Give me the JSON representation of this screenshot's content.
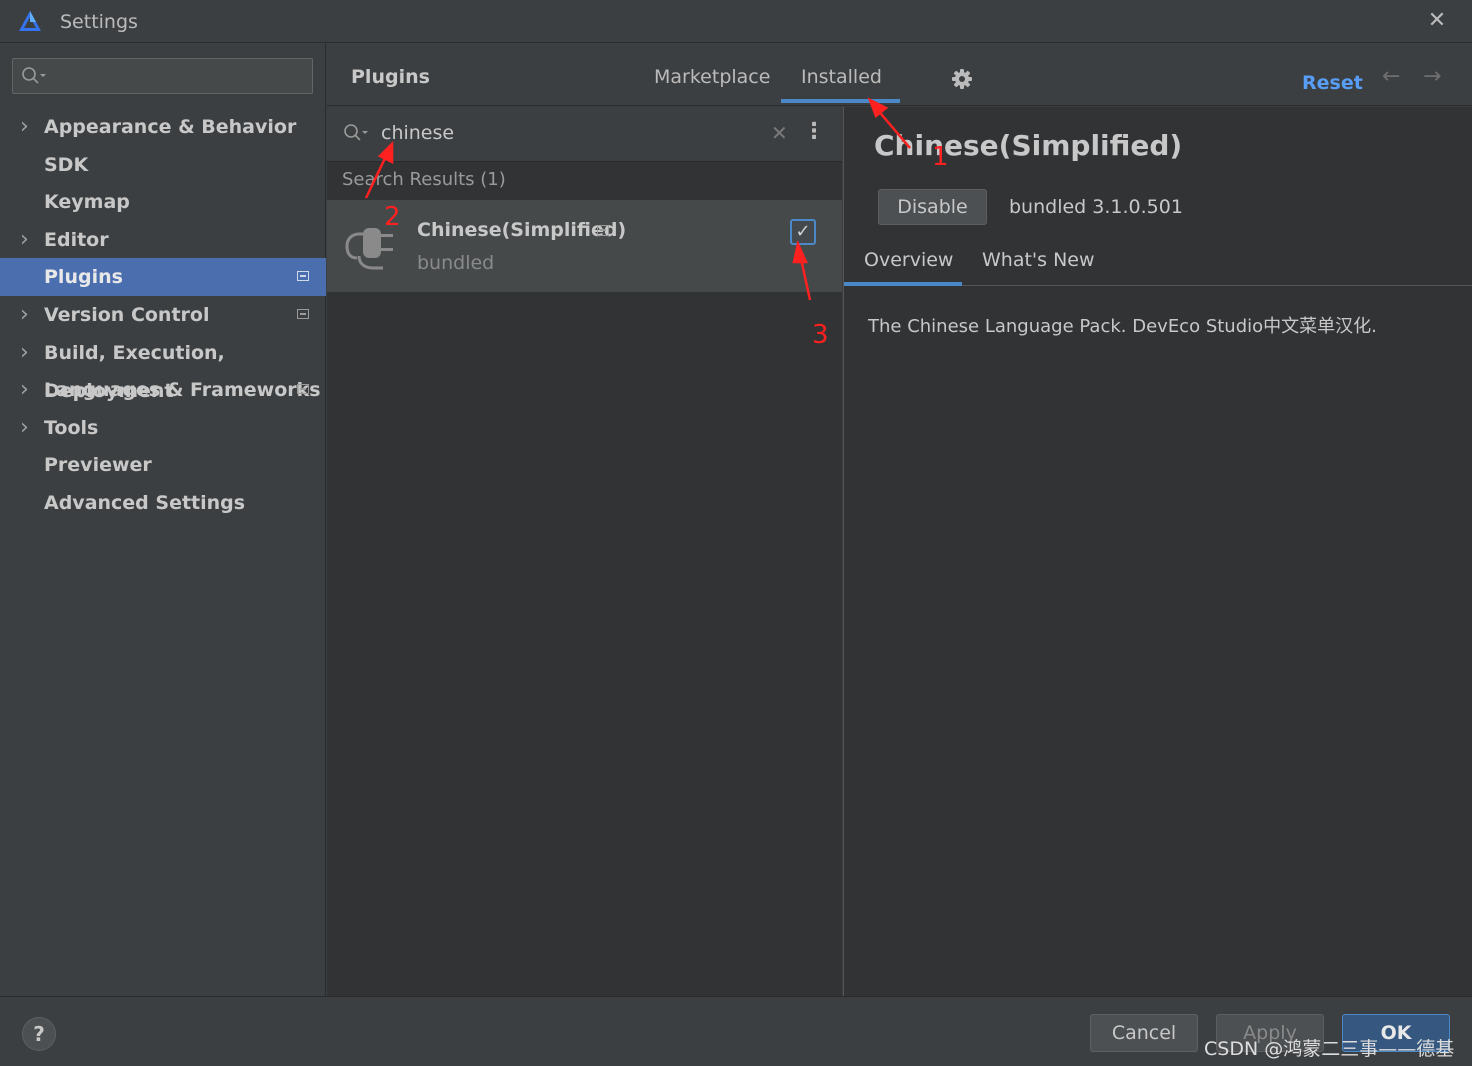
{
  "window": {
    "title": "Settings"
  },
  "sidebar": {
    "search_value": "",
    "items": [
      {
        "label": "Appearance & Behavior",
        "expandable": true,
        "badge": false
      },
      {
        "label": "SDK",
        "expandable": false,
        "badge": false
      },
      {
        "label": "Keymap",
        "expandable": false,
        "badge": false
      },
      {
        "label": "Editor",
        "expandable": true,
        "badge": false
      },
      {
        "label": "Plugins",
        "expandable": false,
        "badge": true,
        "selected": true
      },
      {
        "label": "Version Control",
        "expandable": true,
        "badge": true
      },
      {
        "label": "Build, Execution, Deployment",
        "expandable": true,
        "badge": false
      },
      {
        "label": "Languages & Frameworks",
        "expandable": true,
        "badge": true
      },
      {
        "label": "Tools",
        "expandable": true,
        "badge": false
      },
      {
        "label": "Previewer",
        "expandable": false,
        "badge": false
      },
      {
        "label": "Advanced Settings",
        "expandable": false,
        "badge": false
      }
    ]
  },
  "header": {
    "title": "Plugins",
    "tabs": [
      {
        "label": "Marketplace",
        "active": false
      },
      {
        "label": "Installed",
        "active": true
      }
    ],
    "reset_label": "Reset",
    "nav_back": "←",
    "nav_forward": "→"
  },
  "plugin_list": {
    "search_value": "chinese",
    "clear_glyph": "✕",
    "more_glyph": "⋮",
    "results_label": "Search Results (1)",
    "items": [
      {
        "name": "Chinese(Simplified)",
        "subtitle": "bundled",
        "enabled": true,
        "check_glyph": "✓"
      }
    ]
  },
  "details": {
    "title": "Chinese(Simplified)",
    "disable_label": "Disable",
    "version": "bundled 3.1.0.501",
    "tabs": [
      {
        "label": "Overview",
        "active": true
      },
      {
        "label": "What's New",
        "active": false
      }
    ],
    "description": "The Chinese Language Pack. DevEco Studio中文菜单汉化."
  },
  "footer": {
    "help": "?",
    "cancel_label": "Cancel",
    "apply_label": "Apply",
    "ok_label": "OK"
  },
  "annotations": {
    "marker_1": "1",
    "marker_2": "2",
    "marker_3": "3",
    "color": "#ff2020"
  },
  "watermark": "CSDN @鸿蒙二三事——德基",
  "colors": {
    "accent": "#4a88c7",
    "selection": "#4b6eaf",
    "link": "#589df6"
  }
}
